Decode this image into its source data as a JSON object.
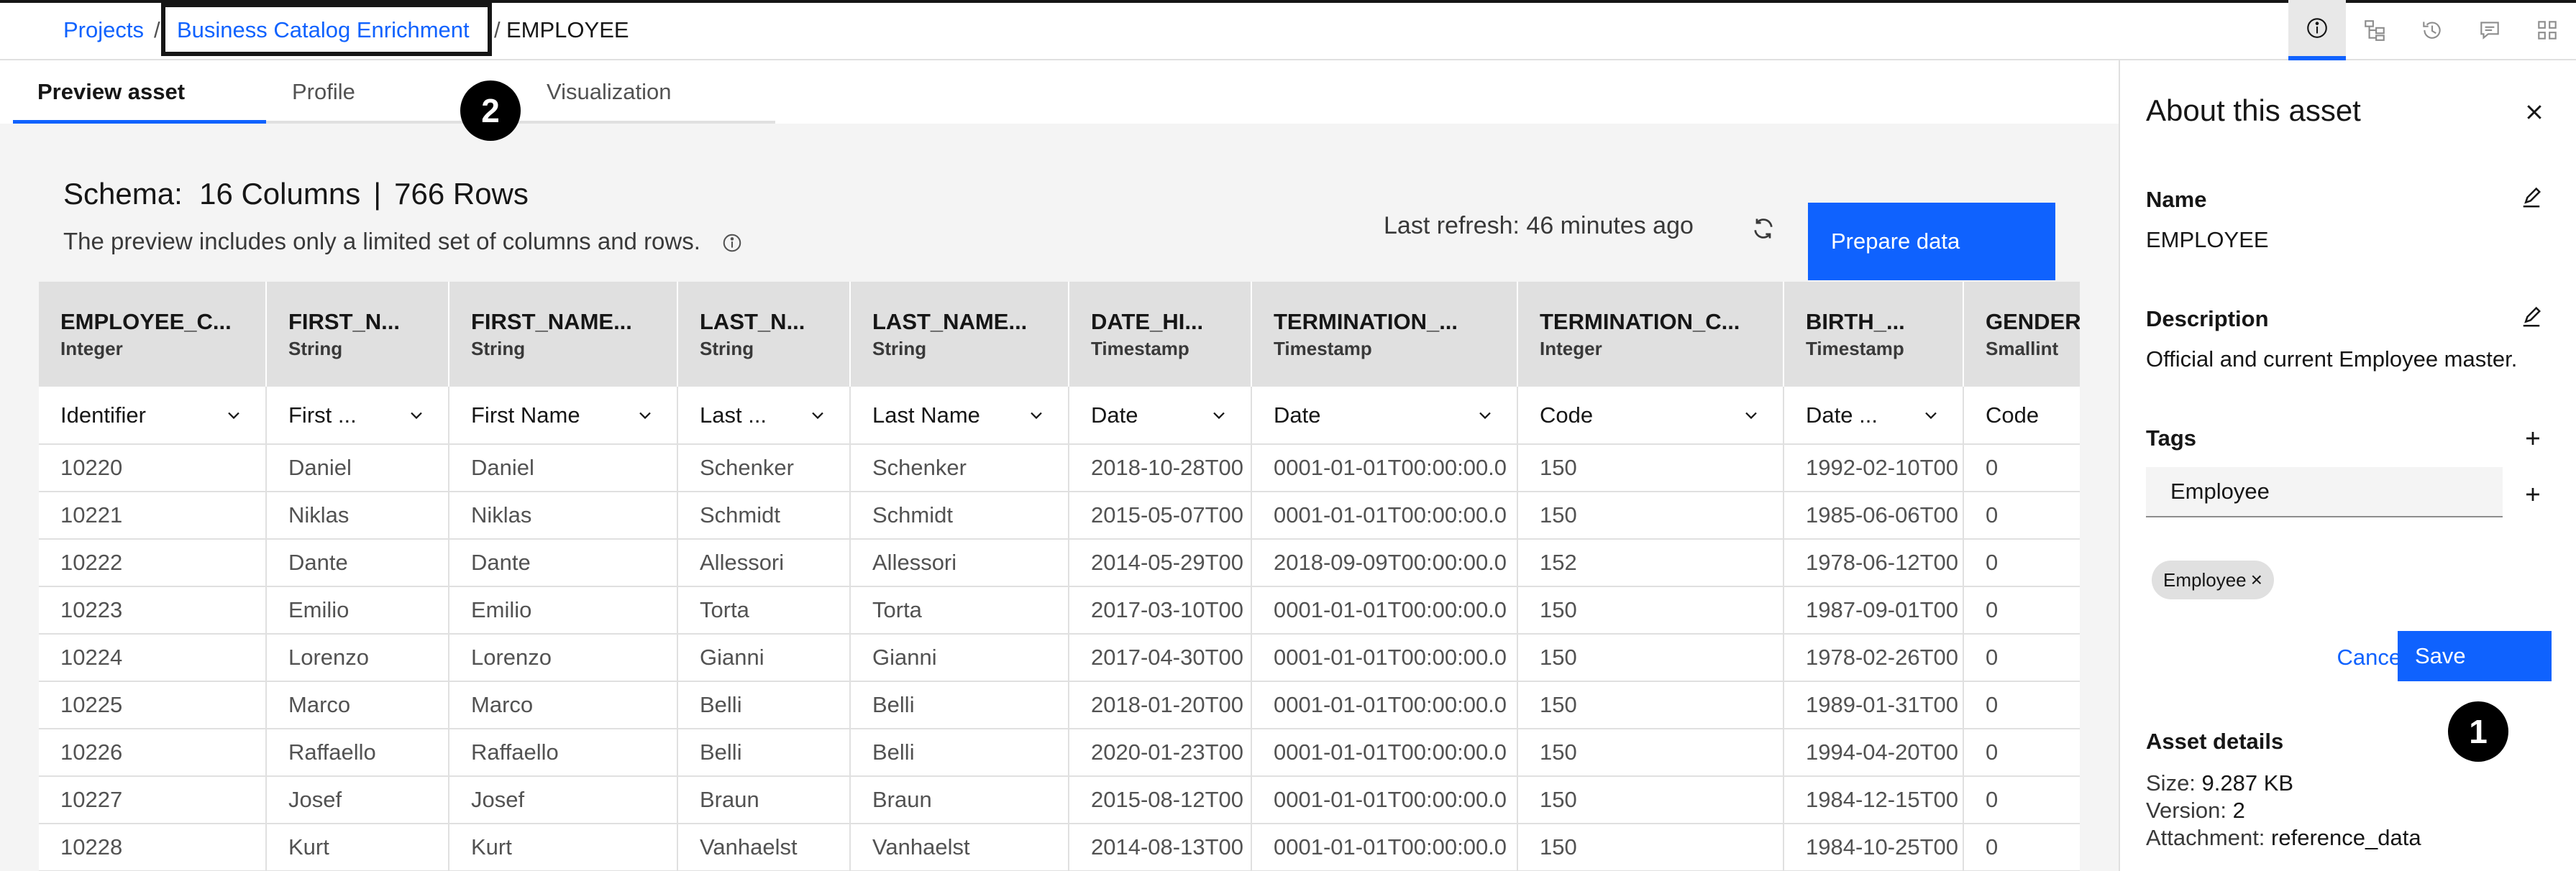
{
  "breadcrumb": {
    "items": [
      "Projects",
      "Business Catalog Enrichment",
      "EMPLOYEE"
    ],
    "separator": "/"
  },
  "toolbar": {
    "icons": [
      "information-icon",
      "lineage-icon",
      "history-icon",
      "comment-icon",
      "apps-icon"
    ],
    "active": "information-icon"
  },
  "tabs": [
    "Preview asset",
    "Profile",
    "Visualization"
  ],
  "active_tab": "Preview asset",
  "callouts": [
    "1",
    "2"
  ],
  "schema": {
    "label": "Schema:",
    "columns": "16 Columns",
    "divider": "|",
    "rows": "766 Rows",
    "note": "The preview includes only a limited set of columns and rows."
  },
  "refresh": {
    "text": "Last refresh: 46 minutes ago"
  },
  "prepare_button": "Prepare data",
  "table": {
    "columns": [
      {
        "name": "EMPLOYEE_C...",
        "type": "Integer",
        "term": "Identifier"
      },
      {
        "name": "FIRST_N...",
        "type": "String",
        "term": "First ..."
      },
      {
        "name": "FIRST_NAME...",
        "type": "String",
        "term": "First Name"
      },
      {
        "name": "LAST_N...",
        "type": "String",
        "term": "Last ..."
      },
      {
        "name": "LAST_NAME...",
        "type": "String",
        "term": "Last Name"
      },
      {
        "name": "DATE_HI...",
        "type": "Timestamp",
        "term": "Date"
      },
      {
        "name": "TERMINATION_...",
        "type": "Timestamp",
        "term": "Date"
      },
      {
        "name": "TERMINATION_C...",
        "type": "Integer",
        "term": "Code"
      },
      {
        "name": "BIRTH_...",
        "type": "Timestamp",
        "term": "Date ..."
      },
      {
        "name": "GENDER",
        "type": "Smallint",
        "term": "Code"
      }
    ],
    "rows": [
      [
        "10220",
        "Daniel",
        "Daniel",
        "Schenker",
        "Schenker",
        "2018-10-28T00",
        "0001-01-01T00:00:00.0",
        "150",
        "1992-02-10T00",
        "0"
      ],
      [
        "10221",
        "Niklas",
        "Niklas",
        "Schmidt",
        "Schmidt",
        "2015-05-07T00",
        "0001-01-01T00:00:00.0",
        "150",
        "1985-06-06T00",
        "0"
      ],
      [
        "10222",
        "Dante",
        "Dante",
        "Allessori",
        "Allessori",
        "2014-05-29T00",
        "2018-09-09T00:00:00.0",
        "152",
        "1978-06-12T00",
        "0"
      ],
      [
        "10223",
        "Emilio",
        "Emilio",
        "Torta",
        "Torta",
        "2017-03-10T00",
        "0001-01-01T00:00:00.0",
        "150",
        "1987-09-01T00",
        "0"
      ],
      [
        "10224",
        "Lorenzo",
        "Lorenzo",
        "Gianni",
        "Gianni",
        "2017-04-30T00",
        "0001-01-01T00:00:00.0",
        "150",
        "1978-02-26T00",
        "0"
      ],
      [
        "10225",
        "Marco",
        "Marco",
        "Belli",
        "Belli",
        "2018-01-20T00",
        "0001-01-01T00:00:00.0",
        "150",
        "1989-01-31T00",
        "0"
      ],
      [
        "10226",
        "Raffaello",
        "Raffaello",
        "Belli",
        "Belli",
        "2020-01-23T00",
        "0001-01-01T00:00:00.0",
        "150",
        "1994-04-20T00",
        "0"
      ],
      [
        "10227",
        "Josef",
        "Josef",
        "Braun",
        "Braun",
        "2015-08-12T00",
        "0001-01-01T00:00:00.0",
        "150",
        "1984-12-15T00",
        "0"
      ],
      [
        "10228",
        "Kurt",
        "Kurt",
        "Vanhaelst",
        "Vanhaelst",
        "2014-08-13T00",
        "0001-01-01T00:00:00.0",
        "150",
        "1984-10-25T00",
        "0"
      ]
    ]
  },
  "panel": {
    "title": "About this asset",
    "name_label": "Name",
    "name_value": "EMPLOYEE",
    "description_label": "Description",
    "description_value": "Official and current Employee master.",
    "tags_label": "Tags",
    "tag_input_value": "Employee",
    "tag_chip": "Employee",
    "cancel": "Cancel",
    "save": "Save",
    "details_label": "Asset details",
    "size_label": "Size:",
    "size_value": "9.287 KB",
    "version_label": "Version:",
    "version_value": "2",
    "attachment_label": "Attachment:",
    "attachment_value": "reference_data"
  }
}
